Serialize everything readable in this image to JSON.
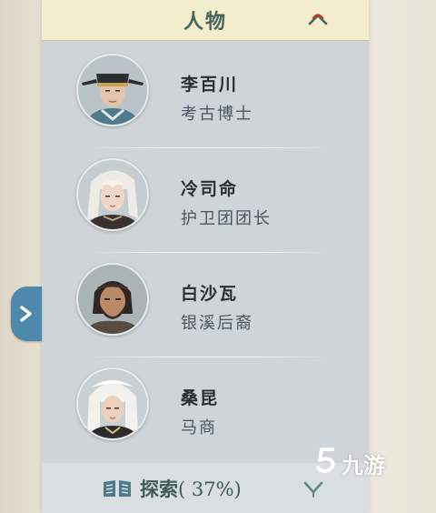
{
  "header": {
    "title": "人物",
    "collapse_icon": "chevron-up-icon"
  },
  "characters": [
    {
      "name": "李百川",
      "role": "考古博士",
      "portrait": "scholar-hat-portrait"
    },
    {
      "name": "冷司命",
      "role": "护卫团团长",
      "portrait": "white-hair-woman-portrait"
    },
    {
      "name": "白沙瓦",
      "role": "银溪后裔",
      "portrait": "bearded-man-portrait"
    },
    {
      "name": "桑昆",
      "role": "马商",
      "portrait": "white-hood-portrait"
    }
  ],
  "footer": {
    "label": "探索",
    "progress_text": "( 37%)",
    "progress": 0.37,
    "icon": "book-icon",
    "expand_icon": "chevron-down-icon"
  },
  "side_tab": {
    "icon": "chevron-right-icon",
    "color": "#4d88ad"
  },
  "watermark": {
    "text": "九游"
  },
  "colors": {
    "header_bg": "#f3eccd",
    "panel_bg": "#cfd4d8",
    "title": "#44655c",
    "accent_red": "#c0392b"
  }
}
